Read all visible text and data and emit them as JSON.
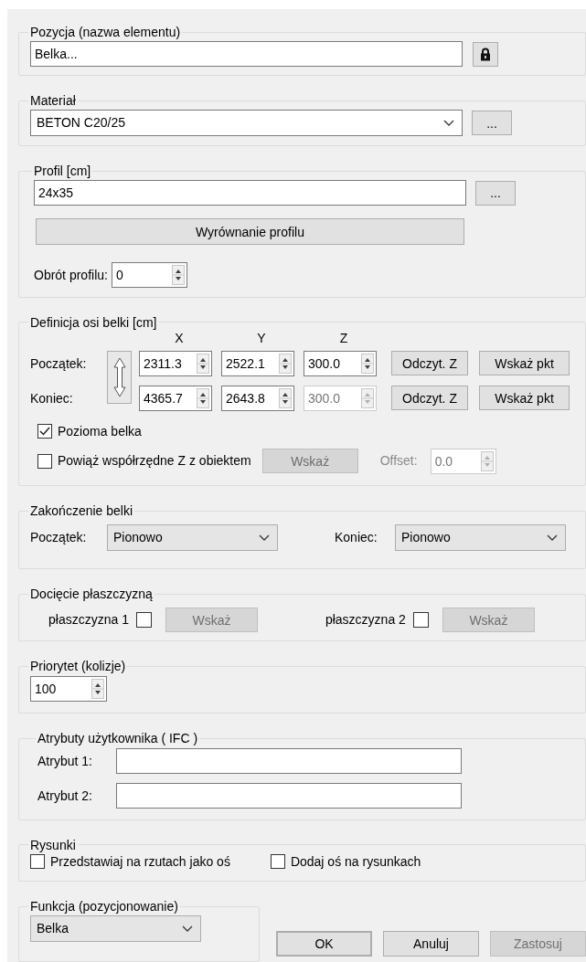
{
  "position": {
    "title": "Pozycja (nazwa elementu)",
    "value": "Belka..."
  },
  "material": {
    "title": "Materiał",
    "value": "BETON C20/25",
    "more_button": "..."
  },
  "profile": {
    "title": "Profil [cm]",
    "value": "24x35",
    "more_button": "...",
    "align_button": "Wyrównanie profilu",
    "rotation_label": "Obrót profilu:",
    "rotation_value": "0"
  },
  "axis": {
    "title": "Definicja osi belki [cm]",
    "columns": [
      "X",
      "Y",
      "Z"
    ],
    "rows": [
      {
        "label": "Początek:",
        "values": [
          {
            "value": "2311.3",
            "disabled": false
          },
          {
            "value": "2522.1",
            "disabled": false
          },
          {
            "value": "300.0",
            "disabled": false
          }
        ],
        "read_button": "Odczyt. Z",
        "pick_button": "Wskaż pkt"
      },
      {
        "label": "Koniec:",
        "values": [
          {
            "value": "4365.7",
            "disabled": false
          },
          {
            "value": "2643.8",
            "disabled": false
          },
          {
            "value": "300.0",
            "disabled": true
          }
        ],
        "read_button": "Odczyt. Z",
        "pick_button": "Wskaż pkt"
      }
    ],
    "horizontal": {
      "label": "Pozioma belka",
      "checked": true
    },
    "link": {
      "label": "Powiąż współrzędne Z z obiektem",
      "checked": false,
      "button": "Wskaż",
      "disabled": true,
      "offset_label": "Offset:",
      "offset_value": "0.0"
    }
  },
  "ending": {
    "title": "Zakończenie belki",
    "start_label": "Początek:",
    "start_value": "Pionowo",
    "end_label": "Koniec:",
    "end_value": "Pionowo"
  },
  "cutting": {
    "title": "Docięcie płaszczyzną",
    "planes": [
      {
        "label": "płaszczyzna 1",
        "checked": false,
        "button": "Wskaż",
        "disabled": true
      },
      {
        "label": "płaszczyzna 2",
        "checked": false,
        "button": "Wskaż",
        "disabled": true
      }
    ]
  },
  "priority": {
    "title": "Priorytet (kolizje)",
    "value": "100"
  },
  "attributes": {
    "title": "Atrybuty użytkownika ( IFC )",
    "rows": [
      {
        "label": "Atrybut 1:"
      },
      {
        "label": "Atrybut 2:"
      }
    ]
  },
  "drawings": {
    "title": "Rysunki",
    "options": [
      {
        "label": "Przedstawiaj na rzutach jako oś",
        "checked": false
      },
      {
        "label": "Dodaj oś na rysunkach",
        "checked": false
      }
    ]
  },
  "function": {
    "title": "Funkcja (pozycjonowanie)",
    "value": "Belka"
  },
  "buttons": [
    {
      "label": "OK",
      "default": true,
      "disabled": false
    },
    {
      "label": "Anuluj",
      "default": false,
      "disabled": false
    },
    {
      "label": "Zastosuj",
      "default": false,
      "disabled": true
    }
  ]
}
